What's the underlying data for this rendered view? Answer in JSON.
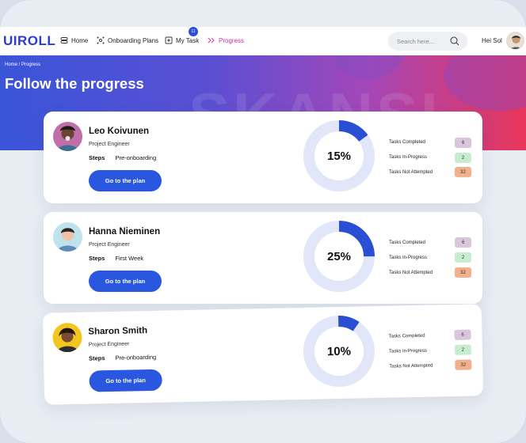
{
  "app": {
    "logo": "UIROLL"
  },
  "nav": {
    "items": [
      {
        "label": "Home",
        "icon": "home-icon"
      },
      {
        "label": "Onboarding Plans",
        "icon": "onboarding-icon"
      },
      {
        "label": "My Task",
        "icon": "task-icon",
        "badge": "11"
      },
      {
        "label": "Progress",
        "icon": "progress-icon"
      }
    ],
    "search_placeholder": "Search here...",
    "user_name": "Hei Sol"
  },
  "page": {
    "breadcrumb": "Home / Progress",
    "title": "Follow the progress",
    "watermark": "SKANSI"
  },
  "stat_labels": {
    "completed": "Tasks Completed",
    "in_progress": "Tasks In-Progress",
    "not_attempted": "Tasks Not  Attempted"
  },
  "people": [
    {
      "name": "Leo Koivunen",
      "role": "Project Engineer",
      "steps_label": "Steps",
      "step": "Pre-onboarding",
      "button": "Go to the plan",
      "percent_label": "15%",
      "percent": 15,
      "completed": "6",
      "in_progress": "2",
      "not_attempted": "32"
    },
    {
      "name": "Hanna Nieminen",
      "role": "Project Engineer",
      "steps_label": "Steps",
      "step": "First Week",
      "button": "Go to the plan",
      "percent_label": "25%",
      "percent": 25,
      "completed": "6",
      "in_progress": "2",
      "not_attempted": "32"
    },
    {
      "name": "Sharon Smith",
      "role": "Project Engineer",
      "steps_label": "Steps",
      "step": "Pre-onboarding",
      "button": "Go to the plan",
      "percent_label": "10%",
      "percent": 10,
      "completed": "6",
      "in_progress": "2",
      "not_attempted": "32"
    }
  ],
  "colors": {
    "accent": "#2a57e0",
    "active_nav": "#c42fa0",
    "donut_track": "#dde3f7",
    "donut_fill": "#2a4fd3"
  }
}
